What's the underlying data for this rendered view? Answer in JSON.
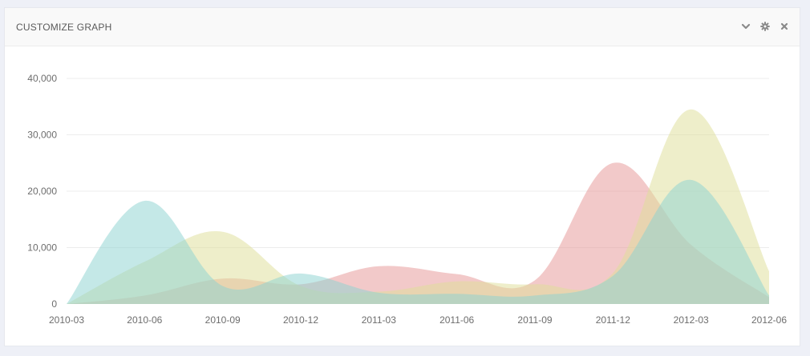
{
  "panel": {
    "title": "CUSTOMIZE GRAPH",
    "icons": [
      "chevron-down-icon",
      "gear-icon",
      "close-icon"
    ]
  },
  "colors": {
    "page_background": "#eef0f7",
    "series_red": "#e79898",
    "series_yellow": "#dfdf9a",
    "series_teal": "#8ed3d1",
    "icon": "#8a8a8a"
  },
  "chart_data": {
    "type": "area",
    "title": "",
    "xlabel": "",
    "ylabel": "",
    "categories": [
      "2010-03",
      "2010-06",
      "2010-09",
      "2010-12",
      "2011-03",
      "2011-06",
      "2011-09",
      "2011-12",
      "2012-03",
      "2012-06"
    ],
    "ylim": [
      0,
      40000
    ],
    "yticks": [
      0,
      10000,
      20000,
      30000,
      40000
    ],
    "ytick_labels": [
      "0",
      "10,000",
      "20,000",
      "30,000",
      "40,000"
    ],
    "grid": true,
    "legend": "none",
    "series": [
      {
        "color": "#e79898",
        "values": [
          0,
          1500,
          4500,
          3500,
          6700,
          5300,
          4200,
          25000,
          10500,
          1200
        ]
      },
      {
        "color": "#dfdf9a",
        "values": [
          0,
          7500,
          12800,
          3200,
          2200,
          4000,
          3500,
          5500,
          34500,
          5800
        ]
      },
      {
        "color": "#8ed3d1",
        "values": [
          0,
          18300,
          3200,
          5400,
          2000,
          1800,
          1500,
          5000,
          22000,
          1500
        ]
      }
    ]
  }
}
